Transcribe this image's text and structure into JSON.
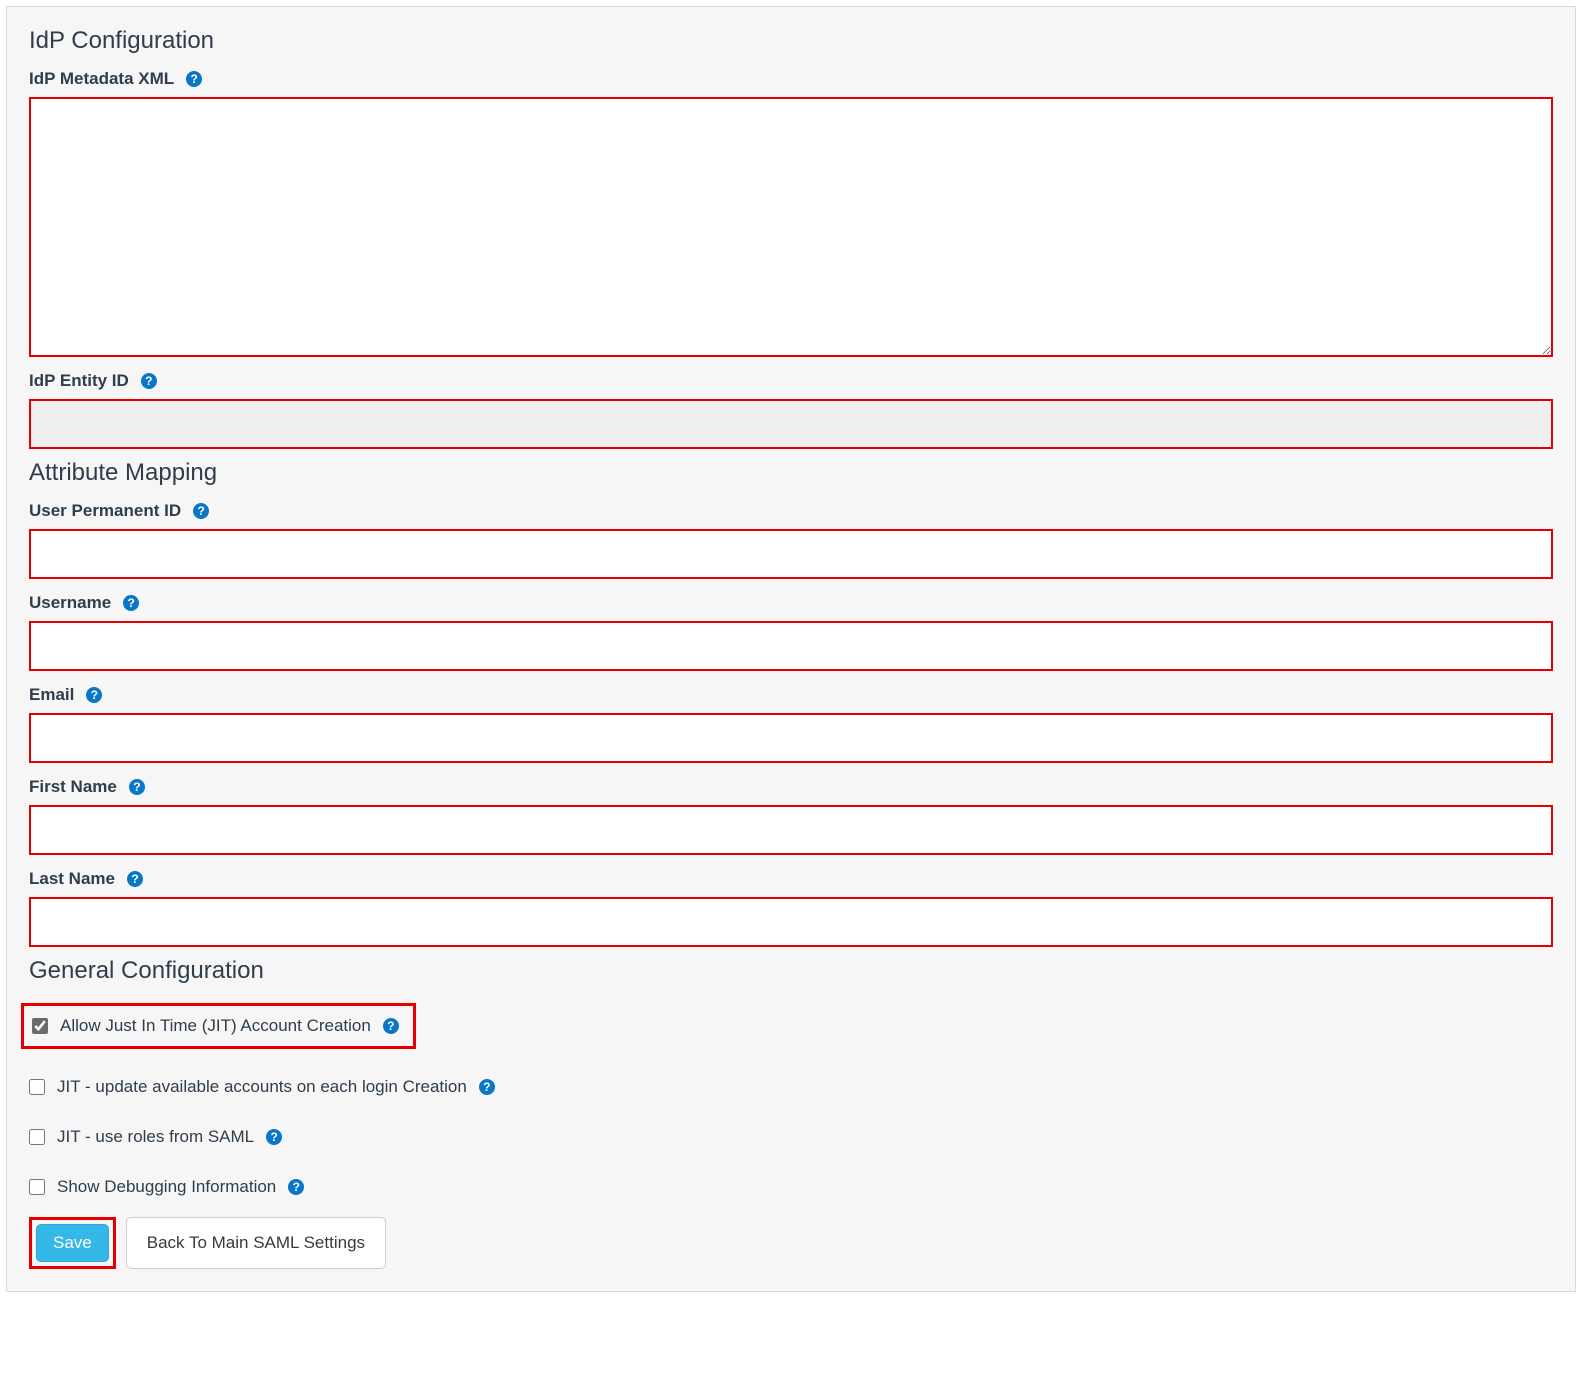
{
  "sections": {
    "idp": "IdP Configuration",
    "attr": "Attribute Mapping",
    "general": "General Configuration"
  },
  "fields": {
    "metadata_xml": {
      "label": "IdP Metadata XML",
      "value": ""
    },
    "entity_id": {
      "label": "IdP Entity ID",
      "value": ""
    },
    "user_perm_id": {
      "label": "User Permanent ID",
      "value": ""
    },
    "username": {
      "label": "Username",
      "value": ""
    },
    "email": {
      "label": "Email",
      "value": ""
    },
    "first_name": {
      "label": "First Name",
      "value": ""
    },
    "last_name": {
      "label": "Last Name",
      "value": ""
    }
  },
  "checks": {
    "jit_create": {
      "label": "Allow Just In Time (JIT) Account Creation",
      "checked": true
    },
    "jit_update": {
      "label": "JIT - update available accounts on each login Creation",
      "checked": false
    },
    "jit_roles": {
      "label": "JIT - use roles from SAML",
      "checked": false
    },
    "show_debug": {
      "label": "Show Debugging Information",
      "checked": false
    }
  },
  "buttons": {
    "save": "Save",
    "back": "Back To Main SAML Settings"
  },
  "help_glyph": "?"
}
